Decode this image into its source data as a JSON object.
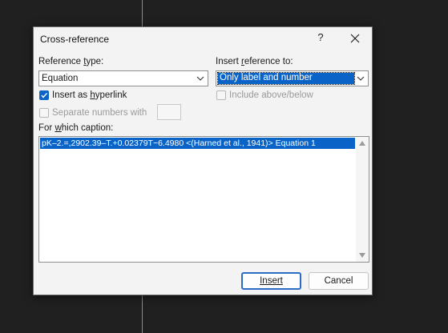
{
  "dialog": {
    "title": "Cross-reference",
    "help": "?",
    "reference_type_label": "Reference type:",
    "reference_type_value": "Equation",
    "insert_reference_label": "Insert reference to:",
    "insert_reference_value": "Only label and number",
    "insert_hyperlink_label": "Insert as hyperlink",
    "insert_hyperlink_checked": true,
    "include_above_below_label": "Include above/below",
    "include_above_below_checked": false,
    "separate_numbers_label": "Separate numbers with",
    "separate_numbers_checked": false,
    "separate_numbers_value": "",
    "caption_label": "For which caption:",
    "captions": [
      "pK–2.=,2902.39–T.+0.02379T−6.4980 <(Harned et al., 1941)> Equation 1"
    ],
    "insert_button": "Insert",
    "cancel_button": "Cancel"
  },
  "colors": {
    "accent": "#0a64c8",
    "background": "#202020",
    "dialog_bg": "#f3f3f3"
  }
}
